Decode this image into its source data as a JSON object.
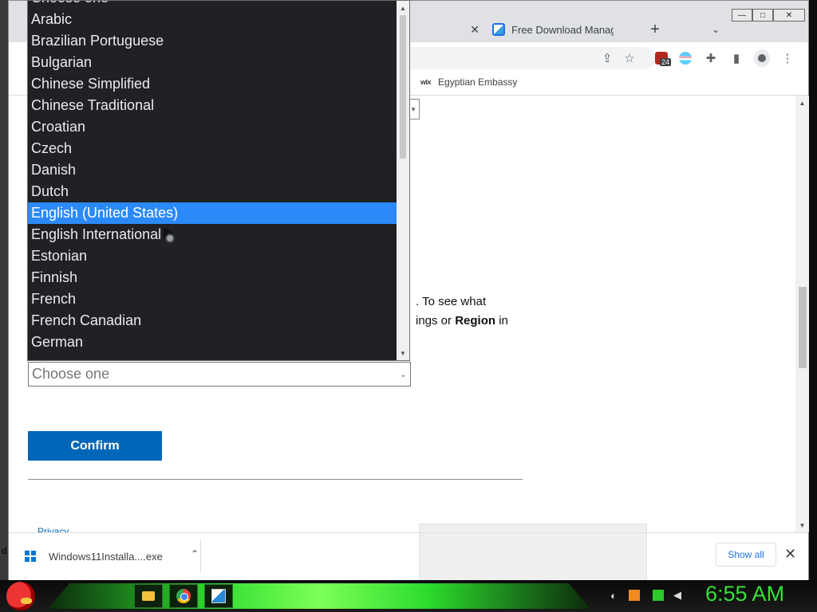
{
  "browser": {
    "tabs": [
      {
        "label": "",
        "close": "✕"
      },
      {
        "label": "Free Download Manage"
      }
    ],
    "new_tab": "+",
    "tab_search": "⌄",
    "window_controls": {
      "minimize": "—",
      "maximize": "□",
      "close": "✕"
    },
    "extension_badge": "24",
    "bookmark": {
      "icon_text": "wix",
      "label": "Egyptian Embassy"
    }
  },
  "page": {
    "text_line1": ". To see what",
    "text_line2_start": "ings or ",
    "text_line2_bold": "Region",
    "text_line2_end": " in",
    "select_placeholder": "Choose one",
    "confirm_label": "Confirm",
    "privacy_label": "Privacy"
  },
  "dropdown": {
    "options": [
      "Choose one",
      "Arabic",
      "Brazilian Portuguese",
      "Bulgarian",
      "Chinese Simplified",
      "Chinese Traditional",
      "Croatian",
      "Czech",
      "Danish",
      "Dutch",
      "English (United States)",
      "English International",
      "Estonian",
      "Finnish",
      "French",
      "French Canadian",
      "German"
    ],
    "selected": "English (United States)"
  },
  "downloads": {
    "file_name": "Windows11Installa....exe",
    "show_all": "Show all",
    "close": "✕"
  },
  "taskbar": {
    "clock": "6:55 AM",
    "edge_letter": "d"
  },
  "colors": {
    "accent_blue": "#0067b8",
    "dropdown_bg": "#202124",
    "selected_option": "#2b8af7",
    "clock_green": "#38e038"
  }
}
